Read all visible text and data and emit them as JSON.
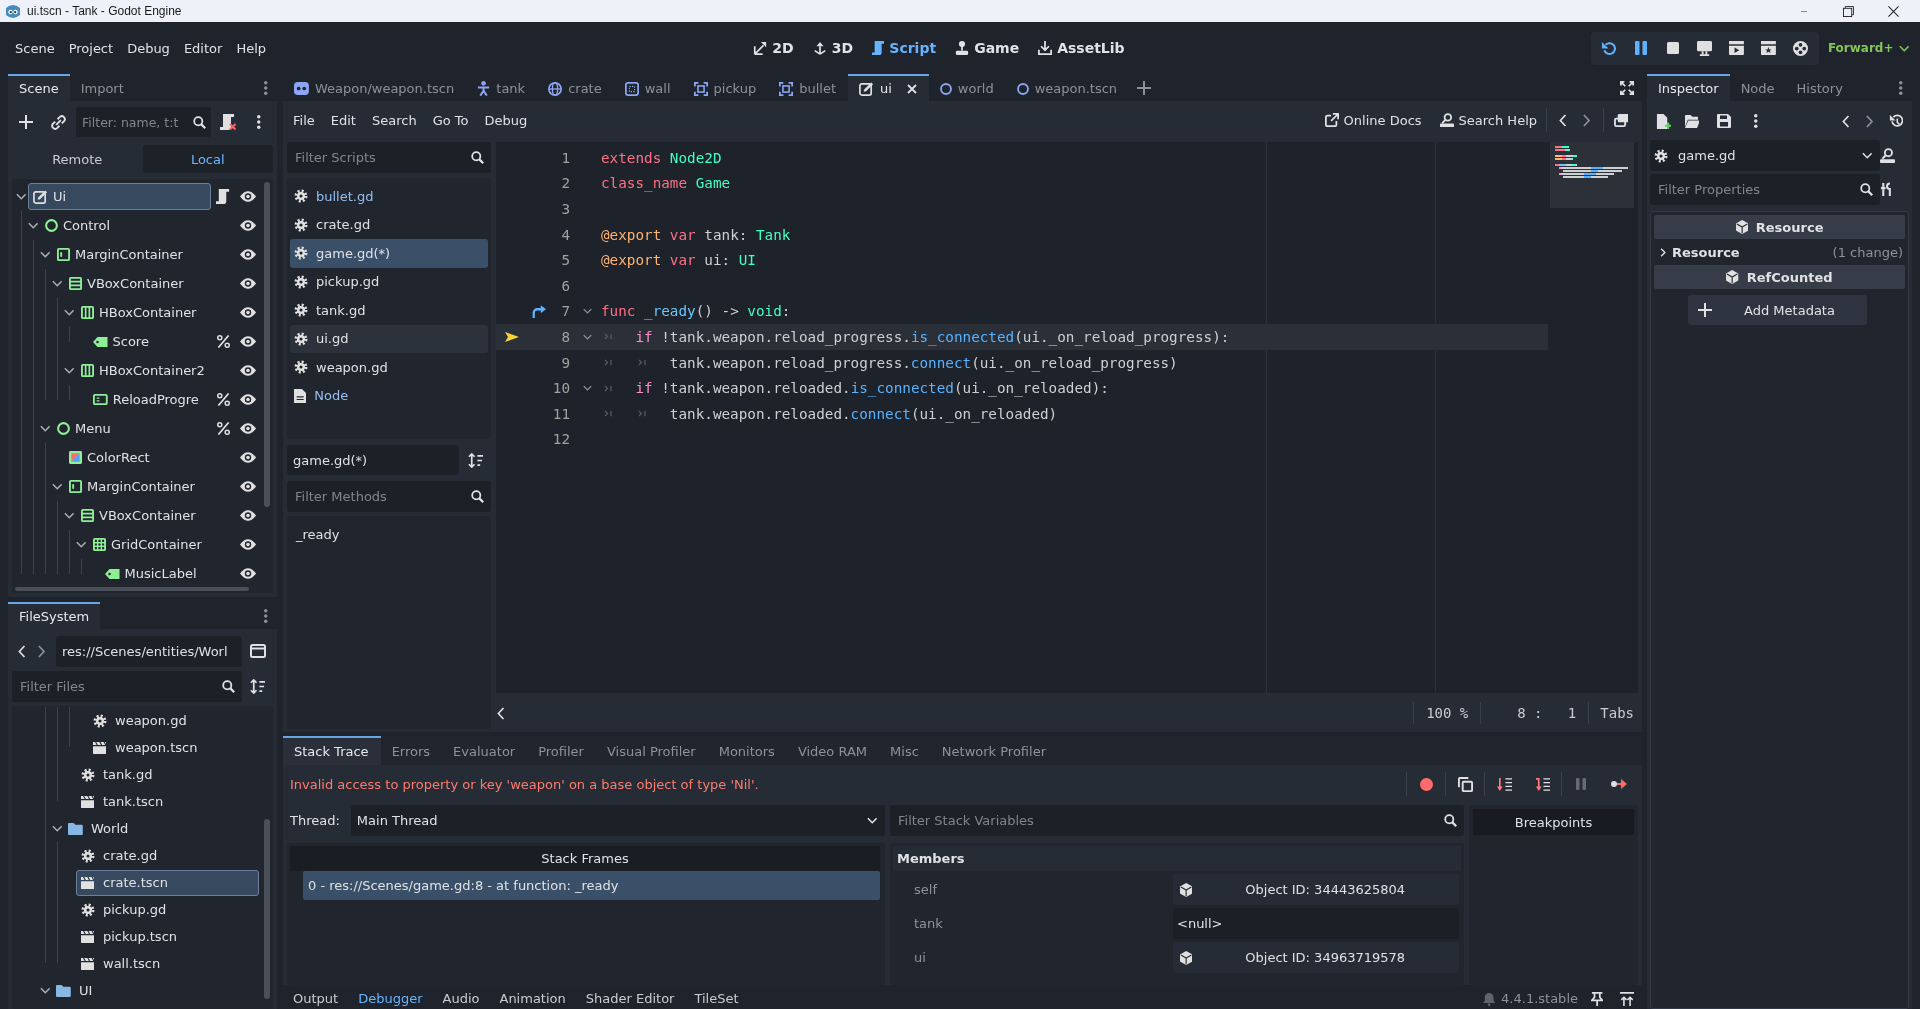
{
  "window": {
    "title": "ui.tscn - Tank - Godot Engine"
  },
  "main_menu": [
    "Scene",
    "Project",
    "Debug",
    "Editor",
    "Help"
  ],
  "workspaces": [
    {
      "label": "2D",
      "kind": "plane",
      "selected": false
    },
    {
      "label": "3D",
      "kind": "space",
      "selected": false
    },
    {
      "label": "Script",
      "kind": "script",
      "selected": true
    },
    {
      "label": "Game",
      "kind": "game",
      "selected": false
    },
    {
      "label": "AssetLib",
      "kind": "assetlib",
      "selected": false
    }
  ],
  "run_bar": [
    {
      "kind": "restart",
      "on": true
    },
    {
      "kind": "pause",
      "on": true
    },
    {
      "kind": "stop",
      "on": false
    },
    {
      "kind": "remote",
      "on": false
    },
    {
      "kind": "playscene",
      "on": false
    },
    {
      "kind": "playcustom",
      "on": false
    },
    {
      "kind": "movie",
      "on": false
    }
  ],
  "renderer": "Forward+",
  "scene_dock": {
    "tabs": [
      {
        "label": "Scene",
        "selected": true
      },
      {
        "label": "Import",
        "selected": false
      }
    ],
    "filter": {
      "placeholder": "Filter: name, t:t"
    },
    "modes": [
      {
        "label": "Remote",
        "selected": false
      },
      {
        "label": "Local",
        "selected": true
      }
    ],
    "tree": [
      {
        "name": "Ui",
        "kind": "edit",
        "selected": true,
        "script": true,
        "unique": false,
        "expanded": true,
        "children": [
          {
            "name": "Control",
            "kind": "control",
            "selected": false,
            "script": false,
            "unique": false,
            "expanded": true,
            "children": [
              {
                "name": "MarginContainer",
                "kind": "margin",
                "selected": false,
                "script": false,
                "unique": false,
                "expanded": true,
                "children": [
                  {
                    "name": "VBoxContainer",
                    "kind": "vbox",
                    "selected": false,
                    "script": false,
                    "unique": false,
                    "expanded": true,
                    "children": [
                      {
                        "name": "HBoxContainer",
                        "kind": "hbox",
                        "selected": false,
                        "script": false,
                        "unique": false,
                        "expanded": true,
                        "children": [
                          {
                            "name": "Score",
                            "kind": "label",
                            "selected": false,
                            "script": false,
                            "unique": true
                          }
                        ]
                      },
                      {
                        "name": "HBoxContainer2",
                        "kind": "hbox",
                        "selected": false,
                        "script": false,
                        "unique": false,
                        "expanded": true,
                        "children": [
                          {
                            "name": "ReloadProgre",
                            "kind": "progress",
                            "selected": false,
                            "script": false,
                            "unique": true
                          }
                        ]
                      }
                    ]
                  }
                ]
              },
              {
                "name": "Menu",
                "kind": "control",
                "selected": false,
                "script": false,
                "unique": true,
                "expanded": true,
                "children": [
                  {
                    "name": "ColorRect",
                    "kind": "colorrect",
                    "selected": false,
                    "script": false,
                    "unique": false
                  },
                  {
                    "name": "MarginContainer",
                    "kind": "margin",
                    "selected": false,
                    "script": false,
                    "unique": false,
                    "expanded": true,
                    "children": [
                      {
                        "name": "VBoxContainer",
                        "kind": "vbox",
                        "selected": false,
                        "script": false,
                        "unique": false,
                        "expanded": true,
                        "children": [
                          {
                            "name": "GridContainer",
                            "kind": "grid",
                            "selected": false,
                            "script": false,
                            "unique": false,
                            "expanded": true,
                            "children": [
                              {
                                "name": "MusicLabel",
                                "kind": "label",
                                "selected": false,
                                "script": false,
                                "unique": false
                              }
                            ]
                          }
                        ]
                      }
                    ]
                  }
                ]
              }
            ]
          }
        ]
      }
    ]
  },
  "filesystem_dock": {
    "tabs": [
      {
        "label": "FileSystem",
        "selected": true
      }
    ],
    "path": "res://Scenes/entities/Worl",
    "filter": {
      "placeholder": "Filter Files"
    },
    "tree": [
      {
        "children": [
          {
            "children": [
              {
                "children": [
                  {
                    "name": "weapon.gd",
                    "kind": "script",
                    "selected": false
                  },
                  {
                    "name": "weapon.tscn",
                    "kind": "scene",
                    "selected": false
                  }
                ]
              },
              {
                "name": "tank.gd",
                "kind": "script",
                "selected": false
              },
              {
                "name": "tank.tscn",
                "kind": "scene",
                "selected": false
              }
            ]
          },
          {
            "name": "World",
            "kind": "folder",
            "selected": false,
            "expanded": true,
            "children": [
              {
                "name": "crate.gd",
                "kind": "script",
                "selected": false
              },
              {
                "name": "crate.tscn",
                "kind": "scene",
                "selected": true
              },
              {
                "name": "pickup.gd",
                "kind": "script",
                "selected": false
              },
              {
                "name": "pickup.tscn",
                "kind": "scene",
                "selected": false
              },
              {
                "name": "wall.tscn",
                "kind": "scene",
                "selected": false
              }
            ]
          }
        ]
      },
      {
        "name": "UI",
        "kind": "folder",
        "selected": false,
        "expanded": true
      }
    ]
  },
  "scene_tabs": [
    {
      "label": "Weapon/weapon.tscn",
      "kind": "face",
      "selected": false
    },
    {
      "label": "tank",
      "kind": "figure",
      "selected": false
    },
    {
      "label": "crate",
      "kind": "globe",
      "selected": false
    },
    {
      "label": "wall",
      "kind": "frame",
      "selected": false
    },
    {
      "label": "pickup",
      "kind": "area",
      "selected": false
    },
    {
      "label": "bullet",
      "kind": "area",
      "selected": false
    },
    {
      "label": "ui",
      "kind": "edit",
      "selected": true
    },
    {
      "label": "world",
      "kind": "ring",
      "selected": false
    },
    {
      "label": "weapon.tscn",
      "kind": "ring",
      "selected": false
    }
  ],
  "script_editor": {
    "menu": [
      "File",
      "Edit",
      "Search",
      "Go To",
      "Debug"
    ],
    "help_buttons": [
      {
        "label": "Online Docs",
        "kind": "external"
      },
      {
        "label": "Search Help",
        "kind": "doc"
      }
    ],
    "scripts_filter": {
      "placeholder": "Filter Scripts"
    },
    "scripts": [
      {
        "name": "bullet.gd",
        "kind": "script",
        "highlighted": true,
        "selected": false,
        "hovered": false
      },
      {
        "name": "crate.gd",
        "kind": "script",
        "highlighted": false,
        "selected": false,
        "hovered": false
      },
      {
        "name": "game.gd(*)",
        "kind": "script",
        "highlighted": false,
        "selected": true,
        "hovered": false
      },
      {
        "name": "pickup.gd",
        "kind": "script",
        "highlighted": false,
        "selected": false,
        "hovered": false
      },
      {
        "name": "tank.gd",
        "kind": "script",
        "highlighted": false,
        "selected": false,
        "hovered": false
      },
      {
        "name": "ui.gd",
        "kind": "script",
        "highlighted": false,
        "selected": false,
        "hovered": true
      },
      {
        "name": "weapon.gd",
        "kind": "script",
        "highlighted": false,
        "selected": false,
        "hovered": false
      },
      {
        "name": "Node",
        "kind": "doc",
        "highlighted": true,
        "selected": false,
        "hovered": false
      }
    ],
    "current_script": "game.gd(*)",
    "methods_filter": {
      "placeholder": "Filter Methods"
    },
    "methods": [
      "_ready"
    ],
    "code": [
      {
        "number": "1",
        "executing": false,
        "overrides": false,
        "foldable": false,
        "current": false,
        "tokens": [
          {
            "t": "extends",
            "kind": "keyword"
          },
          {
            "t": " Node2D",
            "kind": "type"
          }
        ]
      },
      {
        "number": "2",
        "executing": false,
        "overrides": false,
        "foldable": false,
        "current": false,
        "tokens": [
          {
            "t": "class_name",
            "kind": "keyword"
          },
          {
            "t": " Game",
            "kind": "type"
          }
        ]
      },
      {
        "number": "3",
        "executing": false,
        "overrides": false,
        "foldable": false,
        "current": false
      },
      {
        "number": "4",
        "executing": false,
        "overrides": false,
        "foldable": false,
        "current": false,
        "tokens": [
          {
            "t": "@export",
            "kind": "annotation"
          },
          {
            "t": " var",
            "kind": "keyword"
          },
          {
            "t": " tank: ",
            "kind": "plain"
          },
          {
            "t": "Tank",
            "kind": "type"
          }
        ]
      },
      {
        "number": "5",
        "executing": false,
        "overrides": false,
        "foldable": false,
        "current": false,
        "tokens": [
          {
            "t": "@export",
            "kind": "annotation"
          },
          {
            "t": " var",
            "kind": "keyword"
          },
          {
            "t": " ui: ",
            "kind": "plain"
          },
          {
            "t": "UI",
            "kind": "type"
          }
        ]
      },
      {
        "number": "6",
        "executing": false,
        "overrides": false,
        "foldable": false,
        "current": false
      },
      {
        "number": "7",
        "executing": false,
        "overrides": true,
        "foldable": true,
        "current": false,
        "tokens": [
          {
            "t": "func",
            "kind": "keyword"
          },
          {
            "t": " _ready",
            "kind": "funcname"
          },
          {
            "t": "() -> ",
            "kind": "plain"
          },
          {
            "t": "void",
            "kind": "type"
          },
          {
            "t": ":",
            "kind": "plain"
          }
        ]
      },
      {
        "number": "8",
        "executing": true,
        "overrides": false,
        "foldable": true,
        "current": true,
        "tokens": [
          {
            "kind": "tab"
          },
          {
            "t": "if",
            "kind": "control"
          },
          {
            "t": " !tank.weapon.reload_progress.",
            "kind": "plain"
          },
          {
            "t": "is_connected",
            "kind": "call"
          },
          {
            "t": "(ui._on_reload_progress):",
            "kind": "plain"
          }
        ]
      },
      {
        "number": "9",
        "executing": false,
        "overrides": false,
        "foldable": false,
        "current": false,
        "tokens": [
          {
            "kind": "tab"
          },
          {
            "kind": "tab"
          },
          {
            "t": "tank.weapon.reload_progress.",
            "kind": "plain"
          },
          {
            "t": "connect",
            "kind": "call"
          },
          {
            "t": "(ui._on_reload_progress)",
            "kind": "plain"
          }
        ]
      },
      {
        "number": "10",
        "executing": false,
        "overrides": false,
        "foldable": true,
        "current": false,
        "tokens": [
          {
            "kind": "tab"
          },
          {
            "t": "if",
            "kind": "control"
          },
          {
            "t": " !tank.weapon.reloaded.",
            "kind": "plain"
          },
          {
            "t": "is_connected",
            "kind": "call"
          },
          {
            "t": "(ui._on_reloaded):",
            "kind": "plain"
          }
        ]
      },
      {
        "number": "11",
        "executing": false,
        "overrides": false,
        "foldable": false,
        "current": false,
        "tokens": [
          {
            "kind": "tab"
          },
          {
            "kind": "tab"
          },
          {
            "t": "tank.weapon.reloaded.",
            "kind": "plain"
          },
          {
            "t": "connect",
            "kind": "call"
          },
          {
            "t": "(ui._on_reloaded)",
            "kind": "plain"
          }
        ]
      },
      {
        "number": "12",
        "executing": false,
        "overrides": false,
        "foldable": false,
        "current": false
      }
    ],
    "status": {
      "zoom": "100 %",
      "position": "8 :   1",
      "indent": "Tabs"
    }
  },
  "debugger": {
    "tabs": [
      {
        "label": "Stack Trace",
        "selected": true
      },
      {
        "label": "Errors",
        "selected": false
      },
      {
        "label": "Evaluator",
        "selected": false
      },
      {
        "label": "Profiler",
        "selected": false
      },
      {
        "label": "Visual Profiler",
        "selected": false
      },
      {
        "label": "Monitors",
        "selected": false
      },
      {
        "label": "Video RAM",
        "selected": false
      },
      {
        "label": "Misc",
        "selected": false
      },
      {
        "label": "Network Profiler",
        "selected": false
      }
    ],
    "error": "Invalid access to property or key 'weapon' on a base object of type 'Nil'.",
    "tools": [
      {
        "kind": "record",
        "disabled": false
      },
      {
        "kind": "copy",
        "disabled": false
      },
      {
        "kind": "stepinto",
        "disabled": false
      },
      {
        "kind": "stepover",
        "disabled": false
      },
      {
        "kind": "pause",
        "disabled": true
      },
      {
        "kind": "continue",
        "disabled": false
      }
    ],
    "thread_label": "Thread:",
    "thread": "Main Thread",
    "variables_filter": {
      "placeholder": "Filter Stack Variables"
    },
    "frames_header": "Stack Frames",
    "frames": [
      {
        "text": "0 - res://Scenes/game.gd:8 - at function: _ready",
        "selected": true
      }
    ],
    "members_header": "Members",
    "members": [
      {
        "name": "self",
        "kind": "object",
        "value": "Object ID: 34443625804"
      },
      {
        "name": "tank",
        "kind": "null",
        "value": "<null>"
      },
      {
        "name": "ui",
        "kind": "object",
        "value": "Object ID: 34963719578"
      }
    ],
    "breakpoints_header": "Breakpoints"
  },
  "bottom_bar": {
    "tabs": [
      {
        "label": "Output",
        "selected": false
      },
      {
        "label": "Debugger",
        "selected": true
      },
      {
        "label": "Audio",
        "selected": false
      },
      {
        "label": "Animation",
        "selected": false
      },
      {
        "label": "Shader Editor",
        "selected": false
      },
      {
        "label": "TileSet",
        "selected": false
      }
    ],
    "version": "4.4.1.stable"
  },
  "inspector": {
    "tabs": [
      {
        "label": "Inspector",
        "selected": true
      },
      {
        "label": "Node",
        "selected": false
      },
      {
        "label": "History",
        "selected": false
      }
    ],
    "object": "game.gd",
    "filter": {
      "placeholder": "Filter Properties"
    },
    "sections": [
      {
        "kind": "category",
        "label": "Resource"
      },
      {
        "kind": "group",
        "label": "Resource",
        "note": "(1 change)",
        "expanded": false
      },
      {
        "kind": "category",
        "label": "RefCounted"
      }
    ],
    "add_metadata": "Add Metadata"
  }
}
